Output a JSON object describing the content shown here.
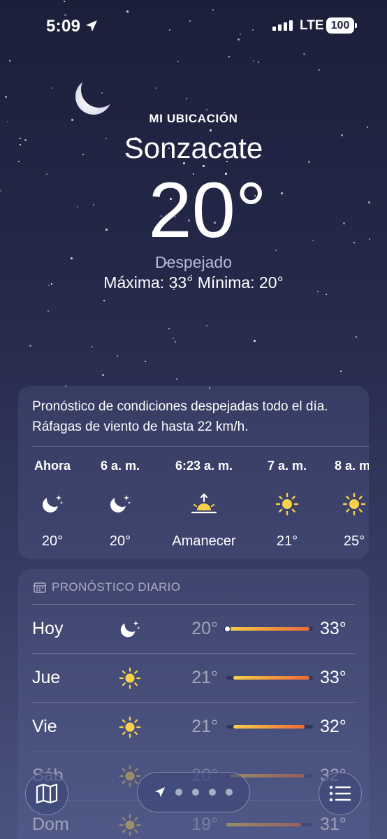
{
  "status_bar": {
    "time": "5:09",
    "network": "LTE",
    "battery": "100"
  },
  "header": {
    "location_label": "MI UBICACIÓN",
    "city": "Sonzacate",
    "temperature": "20°",
    "condition": "Despejado",
    "high_low": "Máxima: 33°  Mínima: 20°"
  },
  "hourly": {
    "summary": "Pronóstico de condiciones despejadas todo el día. Ráfagas de viento de hasta 22 km/h.",
    "items": [
      {
        "label": "Ahora",
        "icon": "moon-stars-icon",
        "temp": "20°"
      },
      {
        "label": "6 a. m.",
        "icon": "moon-stars-icon",
        "temp": "20°"
      },
      {
        "label": "6:23 a. m.",
        "icon": "sunrise-icon",
        "temp": "Amanecer"
      },
      {
        "label": "7 a. m.",
        "icon": "sun-icon",
        "temp": "21°"
      },
      {
        "label": "8 a. m.",
        "icon": "sun-icon",
        "temp": "25°"
      }
    ]
  },
  "daily": {
    "title": "PRONÓSTICO DIARIO",
    "days": [
      {
        "day": "Hoy",
        "icon": "moon-stars-icon",
        "low": "20°",
        "high": "33°",
        "range_start": 0.0,
        "range_end": 0.96
      },
      {
        "day": "Jue",
        "icon": "sun-icon",
        "low": "21°",
        "high": "33°",
        "range_start": 0.08,
        "range_end": 0.96
      },
      {
        "day": "Vie",
        "icon": "sun-icon",
        "low": "21°",
        "high": "32°",
        "range_start": 0.08,
        "range_end": 0.9
      },
      {
        "day": "Sáb",
        "icon": "sun-icon",
        "low": "20°",
        "high": "32°",
        "range_start": 0.04,
        "range_end": 0.9
      },
      {
        "day": "Dom",
        "icon": "sun-icon",
        "low": "19°",
        "high": "31°",
        "range_start": 0.0,
        "range_end": 0.86
      }
    ]
  },
  "toolbar": {
    "page_count": 4
  },
  "colors": {
    "bar_start": "#f7d14a",
    "bar_end": "#ec6a3a",
    "condition_text": "#b7b8de"
  }
}
